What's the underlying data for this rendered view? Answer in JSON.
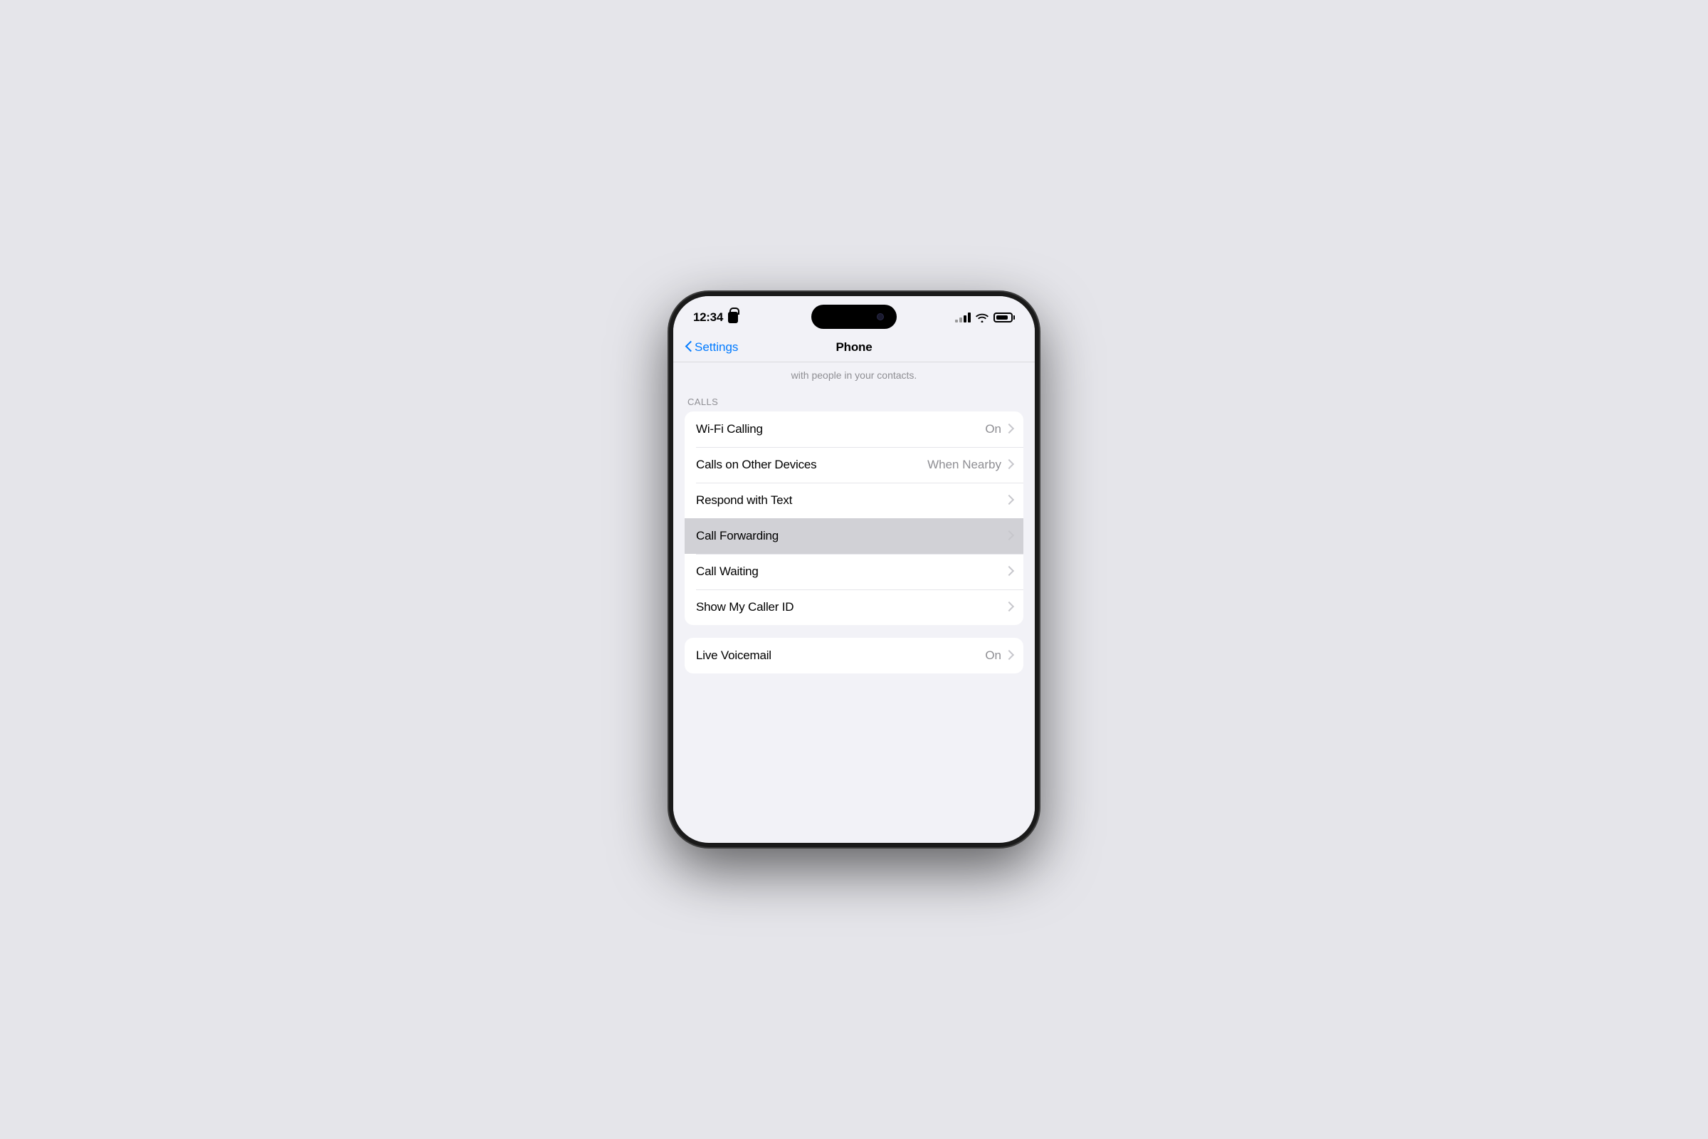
{
  "phone": {
    "status_bar": {
      "time": "12:34",
      "lock_icon": true,
      "signal_label": "signal",
      "wifi_label": "wifi",
      "battery_label": "battery"
    },
    "nav": {
      "back_label": "Settings",
      "title": "Phone"
    },
    "sub_text": "with people in your contacts.",
    "sections": [
      {
        "header": "CALLS",
        "rows": [
          {
            "label": "Wi-Fi Calling",
            "value": "On",
            "highlighted": false
          },
          {
            "label": "Calls on Other Devices",
            "value": "When Nearby",
            "highlighted": false
          },
          {
            "label": "Respond with Text",
            "value": "",
            "highlighted": false
          },
          {
            "label": "Call Forwarding",
            "value": "",
            "highlighted": true
          },
          {
            "label": "Call Waiting",
            "value": "",
            "highlighted": false
          },
          {
            "label": "Show My Caller ID",
            "value": "",
            "highlighted": false
          }
        ]
      }
    ],
    "section2": {
      "rows": [
        {
          "label": "Live Voicemail",
          "value": "On",
          "highlighted": false
        }
      ]
    }
  }
}
